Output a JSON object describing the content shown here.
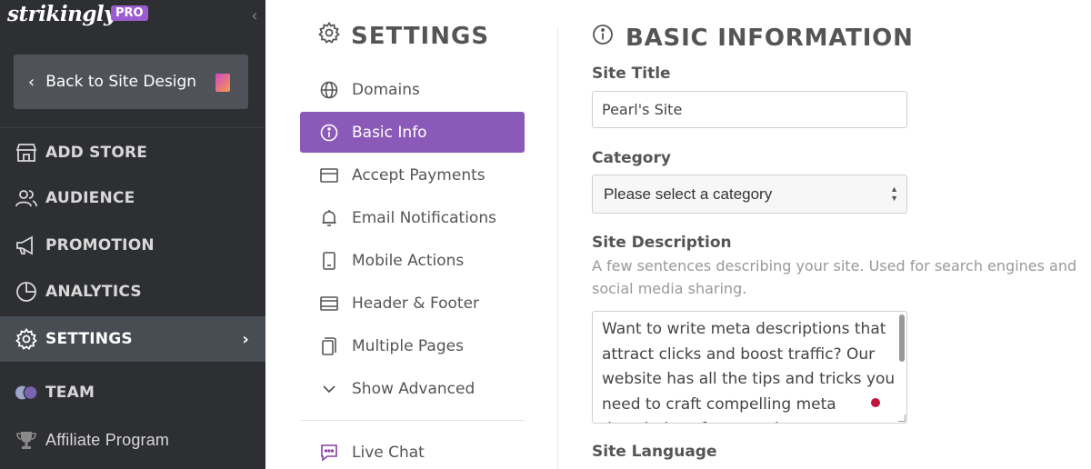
{
  "brand": {
    "logo": "strikingly",
    "badge": "PRO"
  },
  "sidebar": {
    "collapse_icon": "chevron-left-icon",
    "back_button": {
      "label": "Back to Site Design",
      "icon": "document-icon"
    },
    "items": [
      {
        "label": "ADD STORE",
        "icon": "store-icon"
      },
      {
        "label": "AUDIENCE",
        "icon": "users-icon"
      },
      {
        "label": "PROMOTION",
        "icon": "megaphone-icon"
      },
      {
        "label": "ANALYTICS",
        "icon": "pie-chart-icon"
      },
      {
        "label": "SETTINGS",
        "icon": "gear-icon",
        "active": true
      },
      {
        "label": "TEAM",
        "icon": "team-avatars-icon"
      },
      {
        "label": "Affiliate Program",
        "icon": "trophy-icon"
      }
    ]
  },
  "settings": {
    "title": "SETTINGS",
    "items": [
      {
        "label": "Domains",
        "icon": "globe-icon"
      },
      {
        "label": "Basic Info",
        "icon": "info-icon",
        "active": true
      },
      {
        "label": "Accept Payments",
        "icon": "credit-card-icon"
      },
      {
        "label": "Email Notifications",
        "icon": "bell-icon"
      },
      {
        "label": "Mobile Actions",
        "icon": "mobile-icon"
      },
      {
        "label": "Header & Footer",
        "icon": "layout-icon"
      },
      {
        "label": "Multiple Pages",
        "icon": "pages-icon"
      },
      {
        "label": "Show Advanced",
        "icon": "chevron-down-icon"
      },
      {
        "label": "Live Chat",
        "icon": "chat-icon"
      }
    ]
  },
  "form": {
    "title": "BASIC INFORMATION",
    "site_title_label": "Site Title",
    "site_title_value": "Pearl's Site",
    "category_label": "Category",
    "category_value": "Please select a category",
    "description_label": "Site Description",
    "description_hint": "A few sentences describing your site. Used for search engines and social media sharing.",
    "description_value": "Want to write meta descriptions that attract clicks and boost traffic? Our website has all the tips and tricks you need to craft compelling meta descriptions for your site.",
    "language_label": "Site Language"
  },
  "colors": {
    "sidebar_bg": "#2e2f33",
    "accent": "#8b5ab8",
    "active_nav": "#484c53"
  }
}
